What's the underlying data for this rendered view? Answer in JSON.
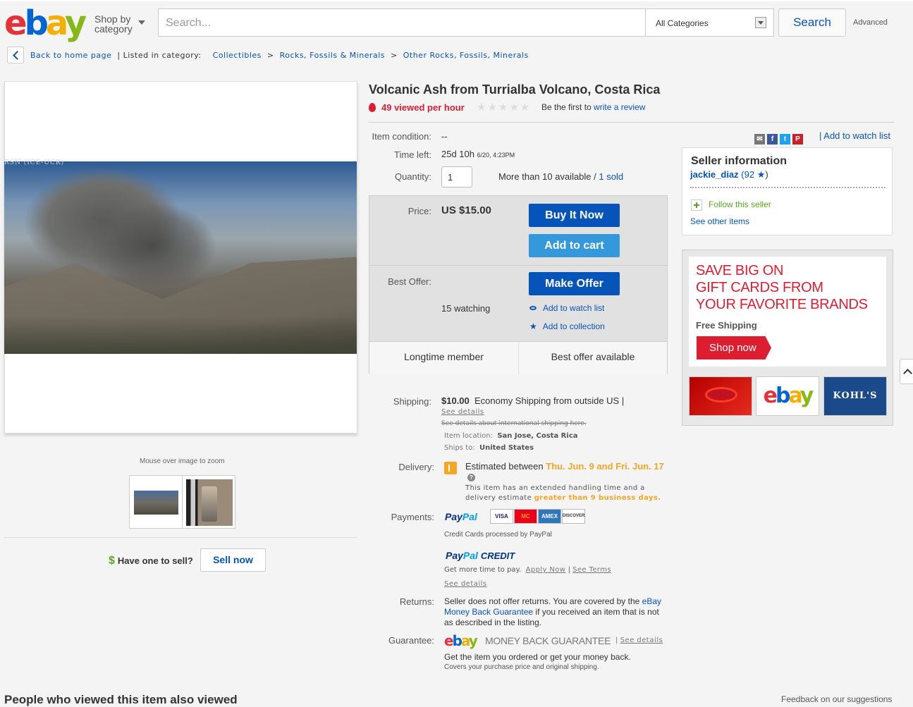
{
  "header": {
    "logo": {
      "e": "e",
      "b": "b",
      "a": "a",
      "y": "y"
    },
    "shop_by_1": "Shop by",
    "shop_by_2": "category",
    "search_placeholder": "Search...",
    "category": "All Categories",
    "search_button": "Search",
    "advanced": "Advanced"
  },
  "breadcrumb": {
    "back": "Back to home page",
    "listed": "| Listed in category:",
    "items": [
      "Collectibles",
      ">",
      "Rocks, Fossils & Minerals",
      ">",
      "Other Rocks, Fossils, Minerals"
    ]
  },
  "gallery": {
    "overlay_text": "RSN (ICE-UCR)",
    "zoom_hint": "Mouse over image to zoom",
    "have_one": "Have one to sell?",
    "dollar": "$",
    "sell_now": "Sell now"
  },
  "item": {
    "title": "Volcanic Ash from Turrialba Volcano, Costa Rica",
    "views": "49 viewed per hour",
    "stars": "★★★★★",
    "first_review": "Be the first to",
    "write_review": "write a review",
    "condition_label": "Item condition:",
    "condition": "--",
    "time_left_label": "Time left:",
    "time_left": "25d 10h",
    "time_left_end": "6/20, 4:23PM",
    "quantity_label": "Quantity:",
    "quantity": "1",
    "available": "More than 10 available /",
    "sold": "1 sold",
    "add_watch_top": "| Add to watch list",
    "price_label": "Price:",
    "price": "US $15.00",
    "buy_now": "Buy It Now",
    "add_to_cart": "Add to cart",
    "best_offer_label": "Best Offer:",
    "make_offer": "Make Offer",
    "watching": "15 watching",
    "add_watch": "Add to watch list",
    "add_collection": "Add to collection",
    "feature1": "Longtime member",
    "feature2": "Best offer available"
  },
  "shipping": {
    "label": "Shipping:",
    "cost": "$10.00",
    "method": "Economy Shipping from outside US |",
    "see_details": "See details",
    "intl": "See details about international shipping here.",
    "location_label": "Item location:",
    "location": "San Jose, Costa Rica",
    "ships_label": "Ships to:",
    "ships_to": "United States",
    "delivery_label": "Delivery:",
    "delivery_prefix": "Estimated between",
    "delivery_dates": "Thu. Jun. 9 and Fri. Jun. 17",
    "question": "?",
    "handling": "This item has an extended handling time and a delivery estimate",
    "handling_em": "greater than 9 business days."
  },
  "payments": {
    "label": "Payments:",
    "paypal_1": "Pay",
    "paypal_2": "Pal",
    "cards": [
      "VISA",
      "MC",
      "AMEX",
      "DISCOVER"
    ],
    "cc_processed": "Credit Cards processed by PayPal",
    "credit_1": "Pay",
    "credit_2": "Pal",
    "credit_3": "CREDIT",
    "more_time": "Get more time to pay.",
    "apply_now": "Apply Now",
    "sep": "|",
    "see_terms": "See Terms",
    "see_details": "See details"
  },
  "returns": {
    "label": "Returns:",
    "text_1": "Seller does not offer returns. You are covered by the",
    "link": "eBay Money Back Guarantee",
    "text_2": "if you received an item that is not as described in the listing."
  },
  "guarantee": {
    "label": "Guarantee:",
    "mbg": "MONEY BACK GUARANTEE",
    "sep": "|",
    "see_details": "See details",
    "get_item": "Get the item you ordered or get your money back.",
    "covers": "Covers your purchase price and original shipping."
  },
  "seller": {
    "heading": "Seller information",
    "name": "jackie_diaz",
    "score": "(92",
    "star": "★",
    "close": ")",
    "follow": "Follow this seller",
    "see_other": "See other items"
  },
  "ad": {
    "headline_1": "SAVE BIG ON",
    "headline_2": "GIFT CARDS FROM",
    "headline_3": "YOUR FAVORITE BRANDS",
    "free_shipping": "Free Shipping",
    "shop_now": "Shop now",
    "card_kohls": "KOHL'S"
  },
  "bottom": {
    "also_viewed": "People who viewed this item also viewed",
    "right": "Feedback on our suggestions"
  },
  "colors": {
    "brand_blue": "#0654ba",
    "accent_red": "#dd1e31",
    "orange": "#f5a623"
  }
}
